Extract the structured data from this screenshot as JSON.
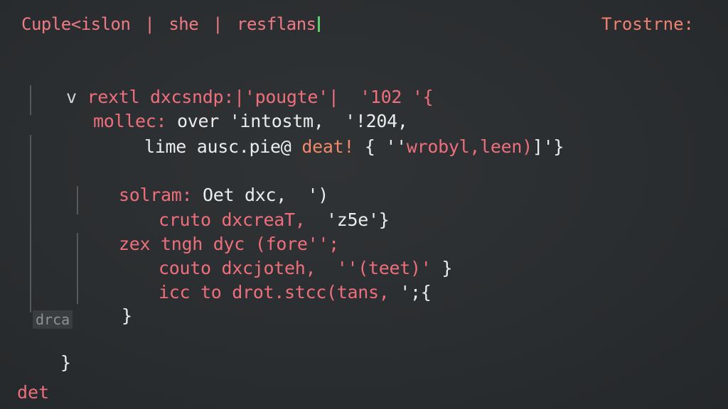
{
  "topbar": {
    "left_part1": "Cuple<islon",
    "left_part2": "she",
    "left_part3": "resflans",
    "sep": "|",
    "right_label": "Trostrne:"
  },
  "code": {
    "l1_fold": "v",
    "l1_kw": "rextl dxcsndp:",
    "l1_rest": "|'pougte'|  '102 '{",
    "l2_kw": "mollec:",
    "l2_rest": "over 'intostm,  '!204,",
    "l3_a": "lime ausc.pie@",
    "l3_b": "deat!",
    "l3_c": "{ ''",
    "l3_d": "wrobyl,leen)",
    "l3_e": "]'}",
    "l4_kw": "solram:",
    "l4_rest": "Oet dxc,  ')",
    "l5_kw": "cruto dxcreaT,",
    "l5_rest": "  'z5e'}",
    "l6_a": "zex",
    "l6_kw": "tngh dyc",
    "l6_rest": "(fore'';",
    "l7_kw": "couto dxcjoteh,",
    "l7_rest": "  ''(teet)'",
    "l7_end": "}",
    "l8_kw": "icc to drot.stcc(tans,",
    "l8_rest": " ';{",
    "l9": "}",
    "l10_badge": "drca",
    "l11": "}",
    "footer": "det"
  }
}
